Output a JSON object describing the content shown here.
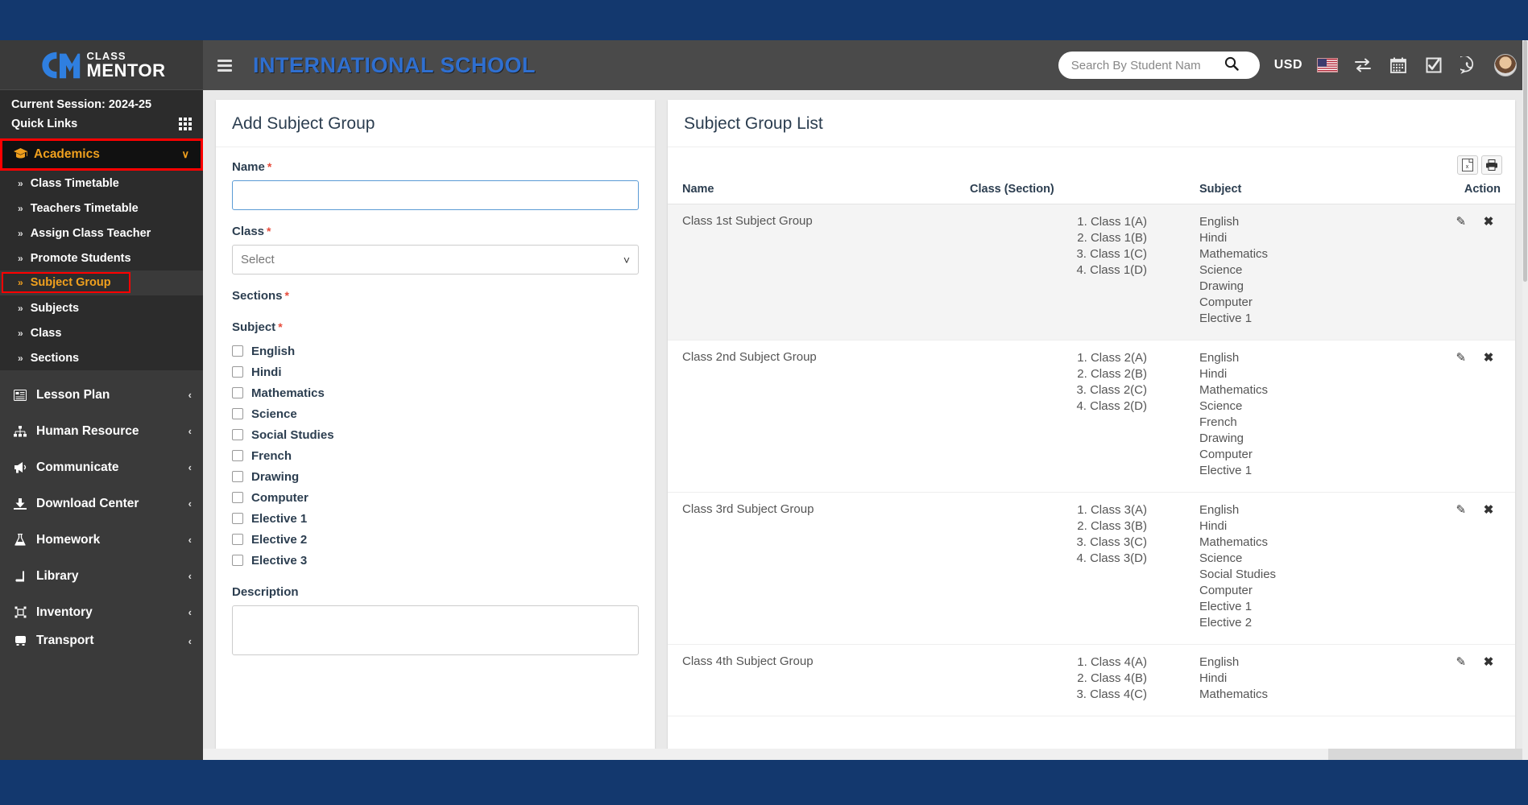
{
  "brand": {
    "top": "CLASS",
    "bottom": "MENTOR"
  },
  "sidebar": {
    "session": "Current Session: 2024-25",
    "quick_links": "Quick Links",
    "academics": {
      "label": "Academics",
      "icon": "graduation-cap-icon",
      "chevron": "∨",
      "highlight_color": "#f0a01e",
      "outline_color": "#ff0000"
    },
    "sub_items": [
      {
        "label": "Class Timetable",
        "active": false
      },
      {
        "label": "Teachers Timetable",
        "active": false
      },
      {
        "label": "Assign Class Teacher",
        "active": false
      },
      {
        "label": "Promote Students",
        "active": false
      },
      {
        "label": "Subject Group",
        "active": true
      },
      {
        "label": "Subjects",
        "active": false
      },
      {
        "label": "Class",
        "active": false
      },
      {
        "label": "Sections",
        "active": false
      }
    ],
    "main_items": [
      {
        "label": "Lesson Plan",
        "icon": "lesson-plan-icon",
        "chevron": "‹"
      },
      {
        "label": "Human Resource",
        "icon": "sitemap-icon",
        "chevron": "‹"
      },
      {
        "label": "Communicate",
        "icon": "megaphone-icon",
        "chevron": "‹"
      },
      {
        "label": "Download Center",
        "icon": "download-icon",
        "chevron": "‹"
      },
      {
        "label": "Homework",
        "icon": "flask-icon",
        "chevron": "‹"
      },
      {
        "label": "Library",
        "icon": "book-icon",
        "chevron": "‹"
      },
      {
        "label": "Inventory",
        "icon": "inventory-icon",
        "chevron": "‹"
      },
      {
        "label": "Transport",
        "icon": "bus-icon",
        "chevron": "‹"
      }
    ]
  },
  "header": {
    "school_title": "INTERNATIONAL SCHOOL",
    "title_color": "#2f6fd0",
    "search_placeholder": "Search By Student Nam",
    "search_value": "",
    "currency": "USD",
    "icons": [
      "search-icon",
      "us-flag-icon",
      "exchange-icon",
      "calendar-icon",
      "checkbox-task-icon",
      "whatsapp-icon",
      "avatar"
    ]
  },
  "form": {
    "title": "Add Subject Group",
    "name_label": "Name",
    "name_value": "",
    "class_label": "Class",
    "class_value": "Select",
    "sections_label": "Sections",
    "subject_label": "Subject",
    "required_mark": "*",
    "subjects": [
      {
        "label": "English",
        "checked": false
      },
      {
        "label": "Hindi",
        "checked": false
      },
      {
        "label": "Mathematics",
        "checked": false
      },
      {
        "label": "Science",
        "checked": false
      },
      {
        "label": "Social Studies",
        "checked": false
      },
      {
        "label": "French",
        "checked": false
      },
      {
        "label": "Drawing",
        "checked": false
      },
      {
        "label": "Computer",
        "checked": false
      },
      {
        "label": "Elective 1",
        "checked": false
      },
      {
        "label": "Elective 2",
        "checked": false
      },
      {
        "label": "Elective 3",
        "checked": false
      }
    ],
    "description_label": "Description",
    "description_value": ""
  },
  "list": {
    "title": "Subject Group List",
    "export_excel": "excel-export-icon",
    "export_print": "print-icon",
    "columns": [
      "Name",
      "Class (Section)",
      "Subject",
      "Action"
    ],
    "rows": [
      {
        "name": "Class 1st Subject Group",
        "classes": [
          "1. Class 1(A)",
          "2. Class 1(B)",
          "3. Class 1(C)",
          "4. Class 1(D)"
        ],
        "subjects": [
          "English",
          "Hindi",
          "Mathematics",
          "Science",
          "Drawing",
          "Computer",
          "Elective 1"
        ],
        "shaded": true
      },
      {
        "name": "Class 2nd Subject Group",
        "classes": [
          "1. Class 2(A)",
          "2. Class 2(B)",
          "3. Class 2(C)",
          "4. Class 2(D)"
        ],
        "subjects": [
          "English",
          "Hindi",
          "Mathematics",
          "Science",
          "French",
          "Drawing",
          "Computer",
          "Elective 1"
        ],
        "shaded": false
      },
      {
        "name": "Class 3rd Subject Group",
        "classes": [
          "1. Class 3(A)",
          "2. Class 3(B)",
          "3. Class 3(C)",
          "4. Class 3(D)"
        ],
        "subjects": [
          "English",
          "Hindi",
          "Mathematics",
          "Science",
          "Social Studies",
          "Computer",
          "Elective 1",
          "Elective 2"
        ],
        "shaded": false
      },
      {
        "name": "Class 4th Subject Group",
        "classes": [
          "1. Class 4(A)",
          "2. Class 4(B)",
          "3. Class 4(C)"
        ],
        "subjects": [
          "English",
          "Hindi",
          "Mathematics"
        ],
        "shaded": false
      }
    ],
    "edit_icon": "pencil-icon",
    "delete_icon": "close-x-icon"
  },
  "colors": {
    "chrome_blue": "#13386e",
    "sidebar": "#3a3a3a",
    "header": "#4a4a4a",
    "accent_orange": "#f0a01e"
  }
}
